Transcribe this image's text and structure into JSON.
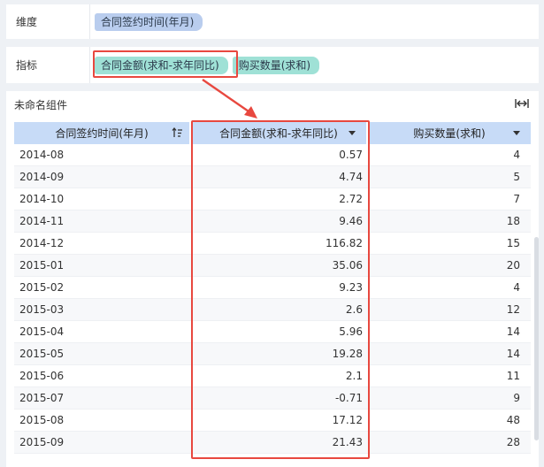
{
  "dimension_shelf": {
    "label": "维度",
    "fields": [
      "合同签约时间(年月)"
    ]
  },
  "metric_shelf": {
    "label": "指标",
    "fields": [
      "合同金额(求和-求年同比)",
      "购买数量(求和)"
    ]
  },
  "component": {
    "title": "未命名组件",
    "expand_icon": "expand-horizontal-icon"
  },
  "table": {
    "headers": [
      "合同签约时间(年月)",
      "合同金额(求和-求年同比)",
      "购买数量(求和)"
    ],
    "rows": [
      [
        "2014-08",
        "0.57",
        "4"
      ],
      [
        "2014-09",
        "4.74",
        "5"
      ],
      [
        "2014-10",
        "2.72",
        "7"
      ],
      [
        "2014-11",
        "9.46",
        "18"
      ],
      [
        "2014-12",
        "116.82",
        "15"
      ],
      [
        "2015-01",
        "35.06",
        "20"
      ],
      [
        "2015-02",
        "9.23",
        "4"
      ],
      [
        "2015-03",
        "2.6",
        "12"
      ],
      [
        "2015-04",
        "5.96",
        "14"
      ],
      [
        "2015-05",
        "19.28",
        "14"
      ],
      [
        "2015-06",
        "2.1",
        "11"
      ],
      [
        "2015-07",
        "-0.71",
        "9"
      ],
      [
        "2015-08",
        "17.12",
        "48"
      ],
      [
        "2015-09",
        "21.43",
        "28"
      ]
    ]
  },
  "colors": {
    "dimension_pill": "#b9cdee",
    "metric_pill": "#9fe1d6",
    "header_bg": "#c7dbf7",
    "highlight": "#e8483f"
  }
}
